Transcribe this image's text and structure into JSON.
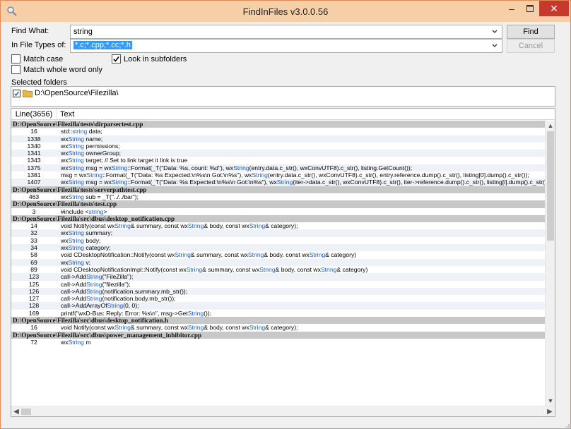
{
  "window": {
    "title": "FindInFiles v3.0.0.56",
    "accent": "#f6cfa6",
    "close_color": "#c7392d"
  },
  "window_controls": {
    "minimize": "–",
    "maximize": "▢",
    "close": "✕"
  },
  "form": {
    "find_what_label": "Find What:",
    "find_what_value": "string",
    "file_types_label": "In File Types of:",
    "file_types_value": "*.c;*.cpp;*.cc;*.h",
    "find_button": "Find",
    "cancel_button": "Cancel",
    "match_case_label": "Match case",
    "match_case_checked": false,
    "match_whole_word_label": "Match whole word only",
    "match_whole_word_checked": false,
    "look_in_subfolders_label": "Look in subfolders",
    "look_in_subfolders_checked": true,
    "selected_folders_label": "Selected folders",
    "folders": [
      {
        "path": "D:\\OpenSource\\Filezilla\\",
        "checked": true
      }
    ]
  },
  "results": {
    "col_line": "Line(3656)",
    "col_text": "Text",
    "rows": [
      {
        "type": "group",
        "text": "D:\\OpenSource\\Filezilla\\tests\\dirparsertest.cpp"
      },
      {
        "line": "16",
        "text": "std::string data;"
      },
      {
        "line": "1338",
        "text": "wxString name;"
      },
      {
        "line": "1340",
        "text": "wxString permissions;"
      },
      {
        "line": "1341",
        "text": "wxString ownerGroup;"
      },
      {
        "line": "1343",
        "text": "wxString target; // Set to link target it link is true"
      },
      {
        "line": "1375",
        "text": "wxString msg = wxString::Format(_T(\"Data: %s, count: %d\"), wxString(entry.data.c_str(), wxConvUTF8).c_str(), listing.GetCount());"
      },
      {
        "line": "1381",
        "text": "msg = wxString::Format(_T(\"Data: %s  Expected:\\n%s\\n  Got:\\n%s\"), wxString(entry.data.c_str(), wxConvUTF8).c_str(), entry.reference.dump().c_str(), listing[0].dump().c_str());"
      },
      {
        "line": "1407",
        "text": "    wxString msg = wxString::Format(_T(\"Data: %s  Expected:\\n%s\\n  Got:\\n%s\"), wxString(iter->data.c_str(), wxConvUTF8).c_str(), iter->reference.dump().c_str(), listing[i].dump().c_str());"
      },
      {
        "type": "group",
        "text": "D:\\OpenSource\\Filezilla\\tests\\serverpathtest.cpp"
      },
      {
        "line": "463",
        "text": "wxString sub = _T(\"../../bar\");"
      },
      {
        "type": "group",
        "text": "D:\\OpenSource\\Filezilla\\tests\\test.cpp"
      },
      {
        "line": "3",
        "text": "#include <string>"
      },
      {
        "type": "group",
        "text": "D:\\OpenSource\\Filezilla\\src\\dbus\\desktop_notification.cpp"
      },
      {
        "line": "14",
        "text": "void Notify(const wxString& summary, const wxString& body, const wxString& category);"
      },
      {
        "line": "32",
        "text": "    wxString summary;"
      },
      {
        "line": "33",
        "text": "    wxString body;"
      },
      {
        "line": "34",
        "text": "    wxString category;"
      },
      {
        "line": "58",
        "text": "void CDesktopNotification::Notify(const wxString& summary, const wxString& body, const wxString& category)"
      },
      {
        "line": "69",
        "text": "wxString v;"
      },
      {
        "line": "89",
        "text": "void CDesktopNotificationImpl::Notify(const wxString& summary, const wxString& body, const wxString& category)"
      },
      {
        "line": "123",
        "text": "call->AddString(\"FileZilla\");"
      },
      {
        "line": "125",
        "text": "call->AddString(\"filezilla\");"
      },
      {
        "line": "126",
        "text": "call->AddString(notification.summary.mb_str());"
      },
      {
        "line": "127",
        "text": "call->AddString(notification.body.mb_str());"
      },
      {
        "line": "128",
        "text": "call->AddArrayOfString(0, 0);"
      },
      {
        "line": "169",
        "text": "        printf(\"wxD-Bus: Reply: Error: %s\\n\", msg->GetString());"
      },
      {
        "type": "group",
        "text": "D:\\OpenSource\\Filezilla\\src\\dbus\\desktop_notification.h"
      },
      {
        "line": "16",
        "text": "void Notify(const wxString& summary, const wxString& body, const wxString& category);"
      },
      {
        "type": "group",
        "text": "D:\\OpenSource\\Filezilla\\src\\dbus\\power_management_inhibitor.cpp"
      },
      {
        "line": "72",
        "text": "wxString m"
      }
    ]
  },
  "icons": {
    "app": "magnifier-icon",
    "folder": "folder-icon"
  }
}
